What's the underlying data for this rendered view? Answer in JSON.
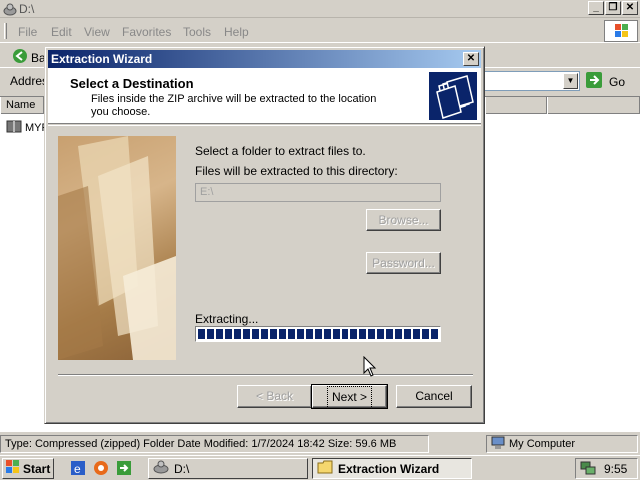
{
  "window": {
    "title": "D:\\",
    "menu": [
      "File",
      "Edit",
      "View",
      "Favorites",
      "Tools",
      "Help"
    ],
    "back_label": "Ba",
    "address_label": "Addres",
    "go_label": "Go",
    "columns": [
      "Name"
    ],
    "file_name": "MYP"
  },
  "status_bar": {
    "left": "Type: Compressed (zipped) Folder Date Modified: 1/7/2024 18:42 Size: 59.6 MB",
    "right": "My Computer"
  },
  "dialog": {
    "title": "Extraction Wizard",
    "heading": "Select a Destination",
    "subheading": "Files inside the ZIP archive will be extracted to the location you choose.",
    "instruction": "Select a folder to extract files to.",
    "directory_label": "Files will be extracted to this directory:",
    "directory_value": "E:\\",
    "browse_label": "Browse...",
    "password_label": "Password...",
    "extracting_label": "Extracting...",
    "progress": 1.0,
    "back_label": "< Back",
    "next_label": "Next >",
    "cancel_label": "Cancel"
  },
  "taskbar": {
    "start_label": "Start",
    "tasks": [
      "D:\\",
      "Extraction Wizard"
    ],
    "clock": "9:55"
  },
  "colors": {
    "title_gradient_start": "#0a246a",
    "title_gradient_end": "#a6caf0",
    "progress_fill": "#0a246a",
    "face": "#d4d0c8"
  }
}
